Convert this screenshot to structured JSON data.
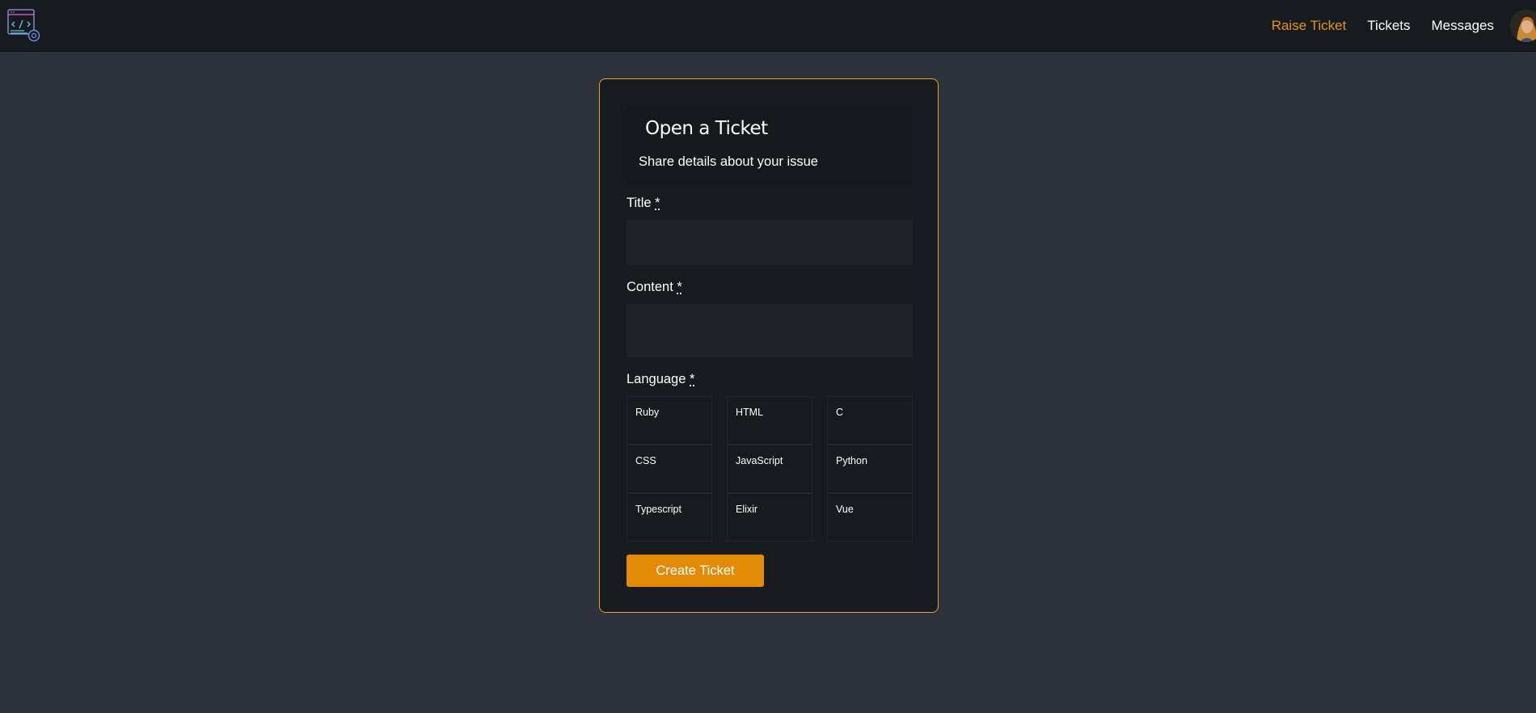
{
  "nav": {
    "links": [
      {
        "label": "Raise Ticket",
        "active": true
      },
      {
        "label": "Tickets",
        "active": false
      },
      {
        "label": "Messages",
        "active": false
      }
    ]
  },
  "form": {
    "title": "Open a Ticket",
    "subtitle": "Share details about your issue",
    "title_label": "Title",
    "content_label": "Content",
    "language_label": "Language",
    "required_mark": "*",
    "title_value": "",
    "content_value": "",
    "languages": [
      "Ruby",
      "HTML",
      "C",
      "CSS",
      "JavaScript",
      "Python",
      "Typescript",
      "Elixir",
      "Vue"
    ],
    "submit_label": "Create Ticket"
  },
  "colors": {
    "accent": "#e38b06",
    "card_border": "#e6a521",
    "background": "#2e323d",
    "surface": "#171a1f"
  }
}
